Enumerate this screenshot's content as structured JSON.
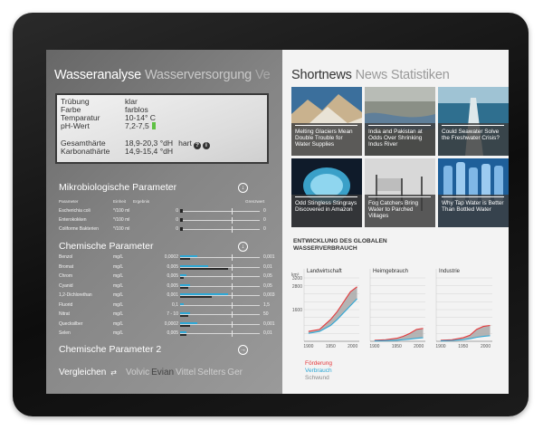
{
  "colors": {
    "foerderung": "#e5383b",
    "verbrauch": "#2ea8d6",
    "schwund": "#9a9a9a",
    "ph_ok": "#5fc144"
  },
  "left": {
    "hub": {
      "current": "Wasseranalyse",
      "next": "Wasserversorgung",
      "cut": "Ve"
    },
    "info": {
      "rows": [
        {
          "k": "Trübung",
          "v": "klar"
        },
        {
          "k": "Farbe",
          "v": "farblos"
        },
        {
          "k": "Temparatur",
          "v": "10-14° C"
        },
        {
          "k": "pH-Wert",
          "v": "7,2-7,5"
        }
      ],
      "rows2": [
        {
          "k": "Gesamthärte",
          "v": "18,9-20,3 °dH",
          "extra": "hart"
        },
        {
          "k": "Karbonathärte",
          "v": "14,9-15,4 °dH"
        }
      ],
      "help_icon": "?",
      "info_icon": "i"
    },
    "micro": {
      "title": "Mikrobiologische Parameter",
      "icon": "chevron-down-icon",
      "headers": {
        "name": "Parameter",
        "unit": "Einheit",
        "result": "Ergebnis",
        "limit": "Grenzwert"
      },
      "rows": [
        {
          "name": "Escherichia coli",
          "unit": "*/100 ml",
          "value": "0",
          "limit": "0"
        },
        {
          "name": "Enterokokken",
          "unit": "*/100 ml",
          "value": "0",
          "limit": "0"
        },
        {
          "name": "Coliforme Bakterien",
          "unit": "*/100 ml",
          "value": "0",
          "limit": "0"
        }
      ]
    },
    "chem": {
      "title": "Chemische Parameter",
      "icon": "chevron-down-icon",
      "rows": [
        {
          "name": "Benzol",
          "unit": "mg/L",
          "value": "0,0002",
          "limit": "0,001",
          "blue": 0.22,
          "dark": 0.12
        },
        {
          "name": "Bromat",
          "unit": "mg/L",
          "value": "0,005",
          "limit": "0,01",
          "blue": 0.35,
          "dark": 0.6
        },
        {
          "name": "Chrom",
          "unit": "mg/L",
          "value": "0,005",
          "limit": "0,05",
          "blue": 0.08,
          "dark": 0.05
        },
        {
          "name": "Cyanid",
          "unit": "mg/L",
          "value": "0,005",
          "limit": "0,05",
          "blue": 0.12,
          "dark": 0.1
        },
        {
          "name": "1,2-Dichlorethan",
          "unit": "mg/L",
          "value": "0,001",
          "limit": "0,003",
          "blue": 0.6,
          "dark": 0.4
        },
        {
          "name": "Fluorid",
          "unit": "mg/L",
          "value": "0,1",
          "limit": "1,5",
          "blue": 0.04,
          "dark": 0.0
        },
        {
          "name": "Nitrat",
          "unit": "mg/L",
          "value": "7 - 10",
          "limit": "50",
          "blue": 0.13,
          "dark": 0.1
        },
        {
          "name": "Quecksilber",
          "unit": "mg/L",
          "value": "0,0002",
          "limit": "0,001",
          "blue": 0.22,
          "dark": 0.12
        },
        {
          "name": "Selen",
          "unit": "mg/L",
          "value": "0,005",
          "limit": "0,01",
          "blue": 0.08,
          "dark": 0.08
        }
      ]
    },
    "chem2": {
      "title": "Chemische Parameter 2",
      "icon": "chevron-right-icon"
    },
    "compare": {
      "label": "Vergleichen",
      "icon": "shuffle-icon",
      "brands": [
        "Volvic",
        "Evian",
        "Vittel",
        "Selters",
        "Ger"
      ]
    }
  },
  "right": {
    "hub": {
      "current": "Shortnews",
      "next": "News",
      "next2": "Statistiken"
    },
    "tiles": [
      {
        "caption": "Melting Glaciers Mean Double Trouble for Water Supplies",
        "img": "glacier"
      },
      {
        "caption": "India and Pakistan at Odds Over Shrinking Indus River",
        "img": "river"
      },
      {
        "caption": "Could Seawater Solve the Freshwater Crisis?",
        "img": "sea"
      },
      {
        "caption": "Odd Stingless Stingrays Discovered in Amazon",
        "img": "ray"
      },
      {
        "caption": "Fog Catchers Bring Water to Parched Villages",
        "img": "fog"
      },
      {
        "caption": "Why Tap Water is Better Than Bottled Water",
        "img": "bottles"
      }
    ],
    "chart_title": "ENTWICKLUNG DES GLOBALEN WASSERVERBRAUCH"
  },
  "chart_data": {
    "type": "area",
    "title": "ENTWICKLUNG DES GLOBALEN WASSERVERBRAUCH",
    "ylabel": "km³",
    "yticks": [
      0,
      400,
      800,
      1200,
      1600,
      2000,
      2400,
      2800,
      3200
    ],
    "ytick_labels": [
      "",
      "",
      "",
      "",
      "1600",
      "",
      "",
      "2800",
      "3200"
    ],
    "ylim": [
      0,
      3200
    ],
    "x": [
      1900,
      1950,
      2000
    ],
    "panels": [
      {
        "name": "Landwirtschaft",
        "x": [
          1900,
          1925,
          1950,
          1965,
          1980,
          1995,
          2010
        ],
        "foerderung": [
          500,
          600,
          1100,
          1500,
          2000,
          2500,
          2750
        ],
        "verbrauch": [
          400,
          500,
          800,
          1100,
          1450,
          1800,
          2150
        ]
      },
      {
        "name": "Heimgebrauch",
        "x": [
          1900,
          1925,
          1950,
          1965,
          1980,
          1995,
          2010
        ],
        "foerderung": [
          50,
          80,
          150,
          250,
          400,
          600,
          650
        ],
        "verbrauch": [
          20,
          30,
          50,
          80,
          110,
          150,
          180
        ]
      },
      {
        "name": "Industrie",
        "x": [
          1900,
          1925,
          1950,
          1965,
          1980,
          1995,
          2010
        ],
        "foerderung": [
          50,
          80,
          180,
          300,
          600,
          750,
          800
        ],
        "verbrauch": [
          20,
          40,
          80,
          130,
          200,
          250,
          280
        ]
      }
    ],
    "series_names": [
      "Förderung",
      "Verbrauch",
      "Schwund"
    ]
  }
}
